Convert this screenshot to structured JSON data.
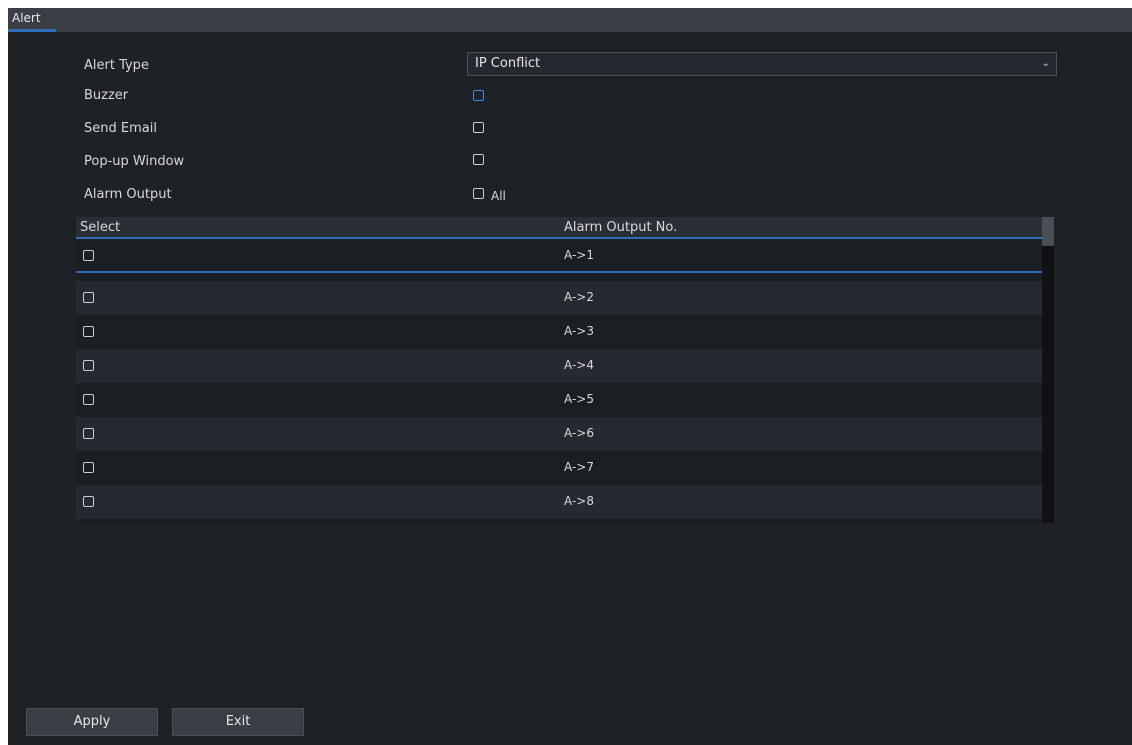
{
  "tabs": [
    {
      "label": "Alert"
    }
  ],
  "form": {
    "alert_type_label": "Alert Type",
    "alert_type_value": "IP Conflict",
    "buzzer_label": "Buzzer",
    "send_email_label": "Send Email",
    "popup_label": "Pop-up Window",
    "alarm_output_label": "Alarm Output",
    "all_label": "All"
  },
  "table": {
    "columns": [
      "Select",
      "Alarm Output No."
    ],
    "rows": [
      {
        "no": "A->1",
        "checked": false
      },
      {
        "no": "A->2",
        "checked": false
      },
      {
        "no": "A->3",
        "checked": false
      },
      {
        "no": "A->4",
        "checked": false
      },
      {
        "no": "A->5",
        "checked": false
      },
      {
        "no": "A->6",
        "checked": false
      },
      {
        "no": "A->7",
        "checked": false
      },
      {
        "no": "A->8",
        "checked": false
      }
    ]
  },
  "buttons": {
    "apply": "Apply",
    "exit": "Exit"
  },
  "colors": {
    "accent": "#2f6fb6",
    "background": "#1e2126",
    "tab_bar": "#3a3e45"
  }
}
